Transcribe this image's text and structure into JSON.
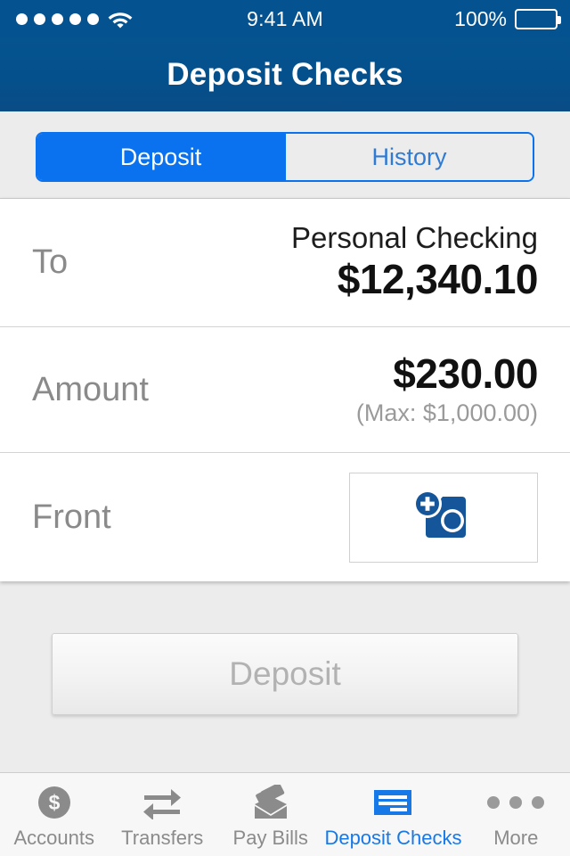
{
  "status_bar": {
    "signal_dots": 5,
    "wifi_icon": "wifi-icon",
    "time": "9:41 AM",
    "battery_percent": "100%",
    "battery_icon": "battery-full-icon"
  },
  "nav": {
    "title": "Deposit Checks",
    "background_color": "#04528f"
  },
  "segmented_control": {
    "selected": "Deposit",
    "accent_color": "#0a72ef",
    "options": [
      {
        "label": "Deposit",
        "active": true
      },
      {
        "label": "History",
        "active": false
      }
    ]
  },
  "form": {
    "to": {
      "label": "To",
      "account_name": "Personal Checking",
      "account_balance": "$12,340.10"
    },
    "amount": {
      "label": "Amount",
      "value": "$230.00",
      "max_note": "(Max: $1,000.00)"
    },
    "front": {
      "label": "Front",
      "capture_icon": "add-camera-icon",
      "icon_color": "#15559a"
    }
  },
  "primary_action": {
    "label": "Deposit",
    "enabled": false,
    "text_color": "#b2b2b2"
  },
  "tab_bar": {
    "active_color": "#1778e8",
    "inactive_color": "#8b8b8b",
    "items": [
      {
        "label": "Accounts",
        "icon": "dollar-circle-icon",
        "active": false
      },
      {
        "label": "Transfers",
        "icon": "transfer-arrows-icon",
        "active": false
      },
      {
        "label": "Pay Bills",
        "icon": "envelope-bills-icon",
        "active": false
      },
      {
        "label": "Deposit Checks",
        "icon": "check-lines-icon",
        "active": true
      },
      {
        "label": "More",
        "icon": "ellipsis-icon",
        "active": false
      }
    ]
  }
}
